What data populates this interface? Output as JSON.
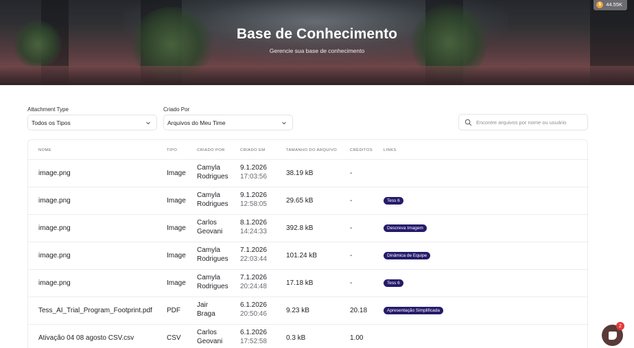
{
  "hero": {
    "title": "Base de Conhecimento",
    "subtitle": "Gerencie sua base de conhecimento",
    "credits": "44.55K"
  },
  "filters": {
    "attachment_label": "Attachment Type",
    "attachment_value": "Todos os Tipos",
    "created_by_label": "Criado Por",
    "created_by_value": "Arquivos do Meu Time",
    "search_placeholder": "Encontre arquivos por nome ou usuário"
  },
  "table": {
    "headers": [
      "NOME",
      "TIPO",
      "CRIADO POR",
      "CRIADO EM",
      "TAMANHO DO ARQUIVO",
      "CRÉDITOS",
      "LINKS"
    ],
    "rows": [
      {
        "name": "image.png",
        "type": "Image",
        "by1": "Camyla",
        "by2": "Rodrigues",
        "date": "9.1.2026",
        "time": "17:03:56",
        "size": "38.19 kB",
        "credits": "-",
        "link": ""
      },
      {
        "name": "image.png",
        "type": "Image",
        "by1": "Camyla",
        "by2": "Rodrigues",
        "date": "9.1.2026",
        "time": "12:58:05",
        "size": "29.65 kB",
        "credits": "-",
        "link": "Tess 6"
      },
      {
        "name": "image.png",
        "type": "Image",
        "by1": "Carlos",
        "by2": "Geovani",
        "date": "8.1.2026",
        "time": "14:24:33",
        "size": "392.8 kB",
        "credits": "-",
        "link": "Descreva Imagem"
      },
      {
        "name": "image.png",
        "type": "Image",
        "by1": "Camyla",
        "by2": "Rodrigues",
        "date": "7.1.2026",
        "time": "22:03:44",
        "size": "101.24 kB",
        "credits": "-",
        "link": "Dinâmica de Equipe"
      },
      {
        "name": "image.png",
        "type": "Image",
        "by1": "Camyla",
        "by2": "Rodrigues",
        "date": "7.1.2026",
        "time": "20:24:48",
        "size": "17.18 kB",
        "credits": "-",
        "link": "Tess 6"
      },
      {
        "name": "Tess_AI_Trial_Program_Footprint.pdf",
        "type": "PDF",
        "by1": "Jair",
        "by2": "Braga",
        "date": "6.1.2026",
        "time": "20:50:46",
        "size": "9.23 kB",
        "credits": "20.18",
        "link": "Apresentação Simplificada"
      },
      {
        "name": "Ativação 04 08 agosto CSV.csv",
        "type": "CSV",
        "by1": "Carlos",
        "by2": "Geovani",
        "date": "6.1.2026",
        "time": "17:52:58",
        "size": "0.3 kB",
        "credits": "1.00",
        "link": ""
      }
    ]
  },
  "chat": {
    "unread": "2"
  },
  "colors": {
    "badge": "#251b6b",
    "coin": "#f0a23a",
    "chat": "#5a3a36",
    "notification": "#e23b3b"
  },
  "icons": [
    "coin-icon",
    "chevron-down-icon",
    "search-icon",
    "chat-icon"
  ]
}
